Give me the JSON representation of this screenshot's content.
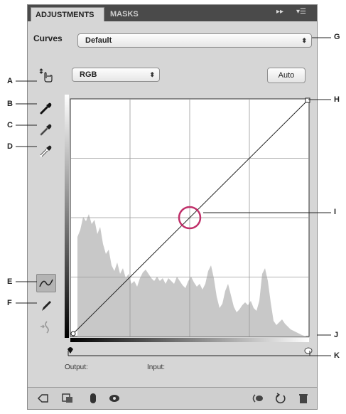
{
  "tabs": [
    {
      "label": "ADJUSTMENTS",
      "active": true
    },
    {
      "label": "MASKS",
      "active": false
    }
  ],
  "tab_controls": {
    "collapse": "▸▸",
    "menu": "▾☰"
  },
  "curves": {
    "label": "Curves",
    "preset_value": "Default",
    "channel_value": "RGB",
    "auto_label": "Auto",
    "output_label": "Output:",
    "input_label": "Input:"
  },
  "callouts": {
    "A": "A",
    "B": "B",
    "C": "C",
    "D": "D",
    "E": "E",
    "F": "F",
    "G": "G",
    "H": "H",
    "I": "I",
    "J": "J",
    "K": "K"
  },
  "tools": [
    {
      "name": "on-image-adjust-icon"
    },
    {
      "name": "black-point-eyedropper-icon"
    },
    {
      "name": "gray-point-eyedropper-icon"
    },
    {
      "name": "white-point-eyedropper-icon"
    },
    {
      "name": "curve-points-icon",
      "selected": true
    },
    {
      "name": "pencil-draw-icon"
    },
    {
      "name": "smooth-curve-icon"
    }
  ],
  "footer_icons": [
    "return-arrow-icon",
    "clip-layer-icon",
    "visibility-eye-icon",
    "view-previous-icon",
    "reset-icon",
    "delete-icon"
  ],
  "colors": {
    "highlight_circle": "#c0306a",
    "histogram": "#c8c8c8",
    "panel": "#d6d6d6"
  }
}
